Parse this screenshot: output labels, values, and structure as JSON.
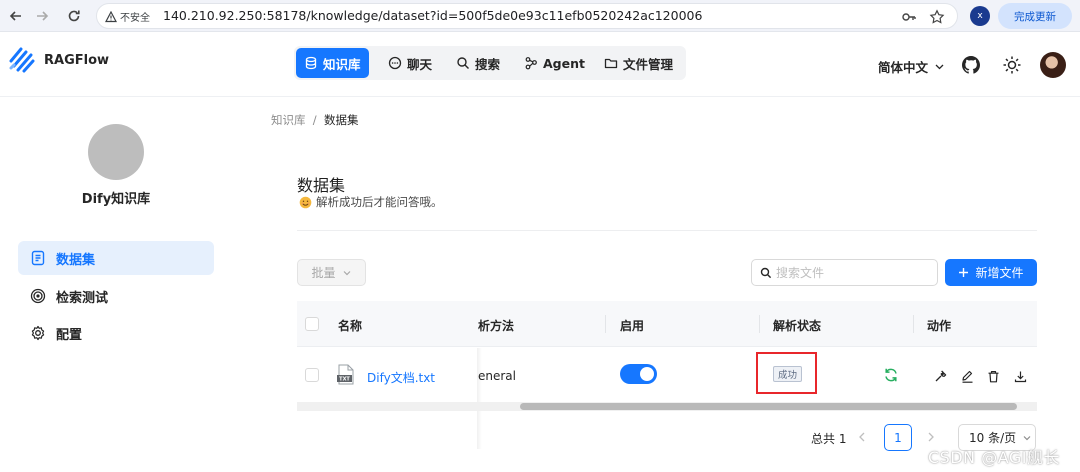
{
  "browser": {
    "insecure_label": "不安全",
    "url": "140.210.92.250:58178/knowledge/dataset?id=500f5de0e93c11efb0520242ac120006",
    "profile_initial": "x",
    "update_label": "完成更新"
  },
  "app": {
    "brand": "RAGFlow",
    "nav": [
      {
        "label": "知识库",
        "icon": "database-icon",
        "active": true
      },
      {
        "label": "聊天",
        "icon": "chat-icon"
      },
      {
        "label": "搜索",
        "icon": "search-icon"
      },
      {
        "label": "Agent",
        "icon": "agent-graph-icon"
      },
      {
        "label": "文件管理",
        "icon": "folder-icon"
      }
    ],
    "language": "简体中文",
    "accent_color": "#1677ff"
  },
  "sidebar": {
    "kb_name": "Dify知识库",
    "items": [
      {
        "label": "数据集",
        "icon": "document-icon",
        "active": true
      },
      {
        "label": "检索测试",
        "icon": "target-icon"
      },
      {
        "label": "配置",
        "icon": "gear-icon"
      }
    ]
  },
  "main": {
    "breadcrumb": [
      "知识库",
      "数据集"
    ],
    "title": "数据集",
    "subtitle": "解析成功后才能问答哦。",
    "batch_label": "批量",
    "search_placeholder": "搜索文件",
    "add_label": "新增文件",
    "table": {
      "columns": [
        "名称",
        "析方法",
        "启用",
        "解析状态",
        "动作"
      ],
      "rows": [
        {
          "name": "Dify文档.txt",
          "file_badge": "TXT",
          "method": "eneral",
          "enabled": true,
          "status": "成功",
          "status_color": "#5d6b82"
        }
      ]
    },
    "pagination": {
      "total": "总共 1",
      "current_page": "1",
      "page_size": "10 条/页"
    }
  },
  "watermark": "CSDN @AGI舰长"
}
